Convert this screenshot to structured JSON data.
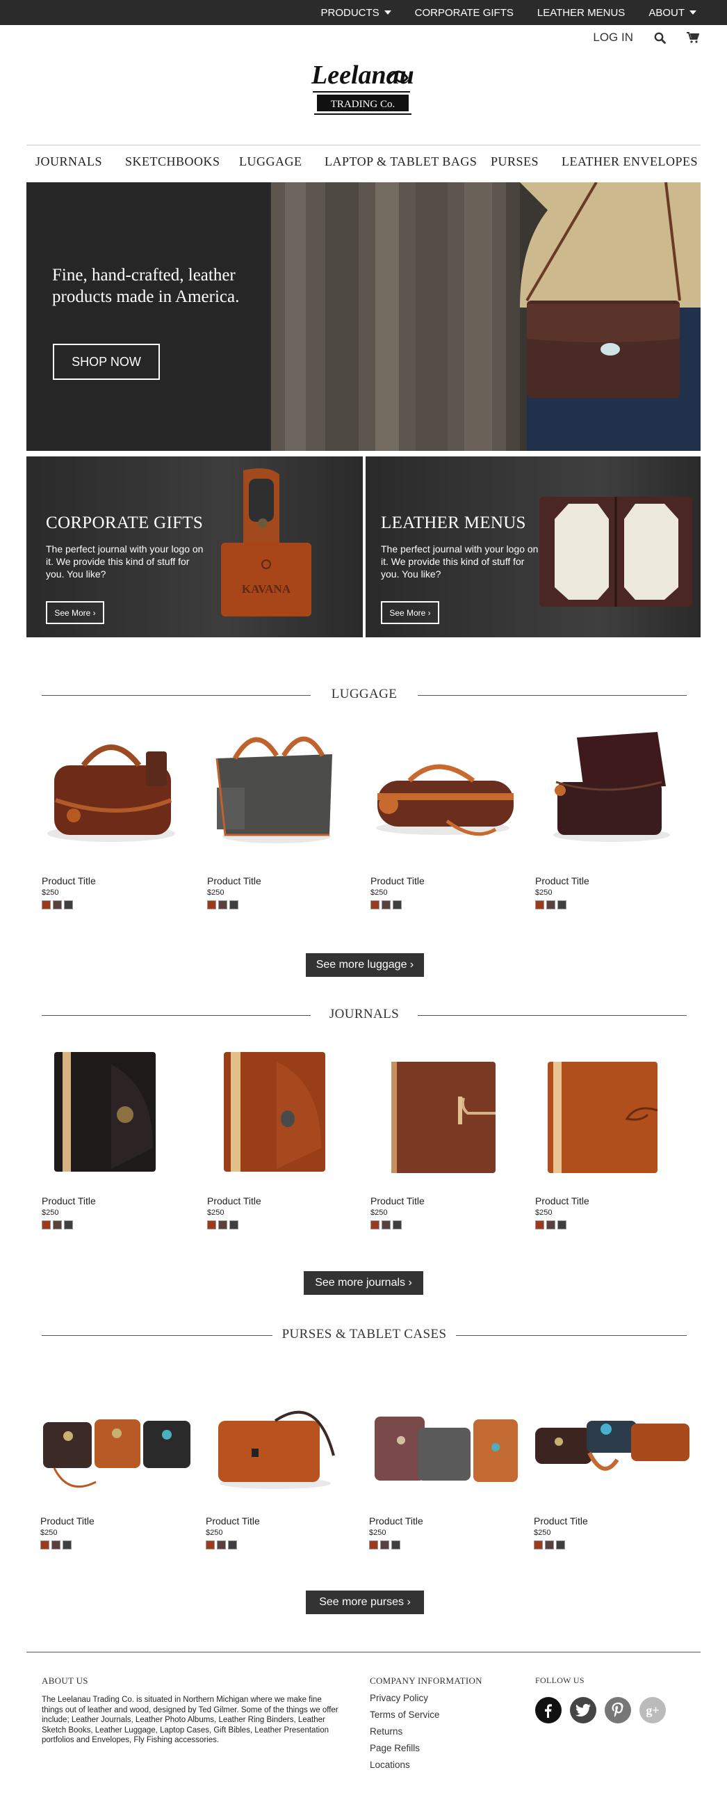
{
  "topbar": {
    "items": [
      {
        "label": "PRODUCTS",
        "dropdown": true
      },
      {
        "label": "CORPORATE GIFTS",
        "dropdown": false
      },
      {
        "label": "LEATHER MENUS",
        "dropdown": false
      },
      {
        "label": "ABOUT",
        "dropdown": true
      }
    ]
  },
  "utility": {
    "login": "LOG IN",
    "search_icon": "search-icon",
    "cart_icon": "cart-icon"
  },
  "logo": {
    "line1": "Leelanau",
    "line2": "TRADING Co."
  },
  "nav": [
    "JOURNALS",
    "SKETCHBOOKS",
    "LUGGAGE",
    "LAPTOP & TABLET BAGS",
    "PURSES",
    "LEATHER ENVELOPES"
  ],
  "hero": {
    "title": "Fine, hand-crafted, leather products made in America.",
    "button": "SHOP NOW"
  },
  "promos": [
    {
      "title": "CORPORATE GIFTS",
      "text": "The perfect journal with your logo on it. We provide this kind of stuff for you. You like?",
      "button": "See More",
      "stamp": "KAVANA"
    },
    {
      "title": "LEATHER MENUS",
      "text": "The perfect journal with your logo on it. We provide this kind of stuff for you. You like?",
      "button": "See More"
    }
  ],
  "sections": [
    {
      "heading": "LUGGAGE",
      "more": "See more luggage",
      "products": [
        {
          "title": "Product Title",
          "price": "$250"
        },
        {
          "title": "Product Title",
          "price": "$250"
        },
        {
          "title": "Product Title",
          "price": "$250"
        },
        {
          "title": "Product Title",
          "price": "$250"
        }
      ]
    },
    {
      "heading": "JOURNALS",
      "more": "See more journals",
      "products": [
        {
          "title": "Product Title",
          "price": "$250"
        },
        {
          "title": "Product Title",
          "price": "$250"
        },
        {
          "title": "Product Title",
          "price": "$250"
        },
        {
          "title": "Product Title",
          "price": "$250"
        }
      ]
    },
    {
      "heading": "PURSES & TABLET CASES",
      "more": "See more purses",
      "products": [
        {
          "title": "Product Title",
          "price": "$250"
        },
        {
          "title": "Product Title",
          "price": "$250"
        },
        {
          "title": "Product Title",
          "price": "$250"
        },
        {
          "title": "Product Title",
          "price": "$250"
        }
      ]
    }
  ],
  "swatches": [
    "#9c3a1c",
    "#5a4140",
    "#3f3f3f"
  ],
  "footer": {
    "about_heading": "ABOUT US",
    "about_text": "The Leelanau Trading Co. is situated in Northern Michigan where we make fine things out of leather and wood, designed by Ted Gilmer. Some of the things we offer include; Leather Journals, Leather Photo Albums, Leather Ring Binders, Leather Sketch Books, Leather Luggage, Laptop Cases, Gift Bibles, Leather Presentation portfolios and Envelopes, Fly Fishing accessories.",
    "company_heading": "COMPANY INFORMATION",
    "company_links": [
      "Privacy Policy",
      "Terms of Service",
      "Returns",
      "Page Refills",
      "Locations"
    ],
    "follow_heading": "FOLLOW US",
    "social": [
      "facebook-icon",
      "twitter-icon",
      "pinterest-icon",
      "google-plus-icon"
    ]
  },
  "colors": {
    "topbar": "#2b2b2b",
    "button_dark": "#333333",
    "leather": "#9c3a1c"
  }
}
